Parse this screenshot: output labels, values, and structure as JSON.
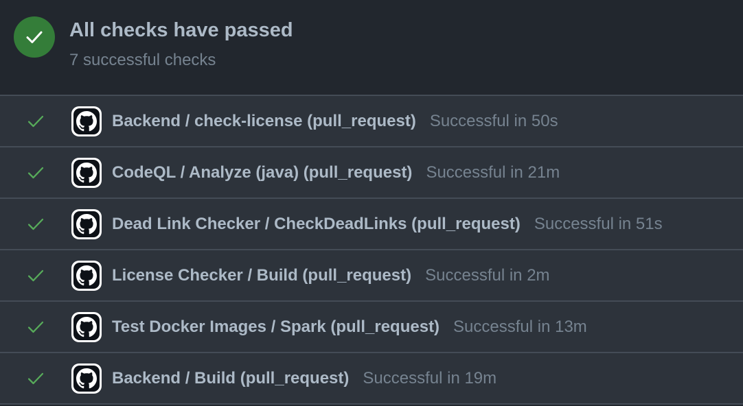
{
  "header": {
    "title": "All checks have passed",
    "subtitle": "7 successful checks",
    "status_icon": "check-circle-icon",
    "status_color": "#347d39"
  },
  "checks": [
    {
      "name": "Backend / check-license (pull_request)",
      "status": "Successful in 50s",
      "icon": "github-icon"
    },
    {
      "name": "CodeQL / Analyze (java) (pull_request)",
      "status": "Successful in 21m",
      "icon": "github-icon"
    },
    {
      "name": "Dead Link Checker / CheckDeadLinks (pull_request)",
      "status": "Successful in 51s",
      "icon": "github-icon"
    },
    {
      "name": "License Checker / Build (pull_request)",
      "status": "Successful in 2m",
      "icon": "github-icon"
    },
    {
      "name": "Test Docker Images / Spark (pull_request)",
      "status": "Successful in 13m",
      "icon": "github-icon"
    },
    {
      "name": "Backend / Build (pull_request)",
      "status": "Successful in 19m",
      "icon": "github-icon"
    }
  ],
  "colors": {
    "success": "#57ab5a",
    "background": "#22272e",
    "row_background": "#2d333b",
    "border": "#444c56"
  }
}
